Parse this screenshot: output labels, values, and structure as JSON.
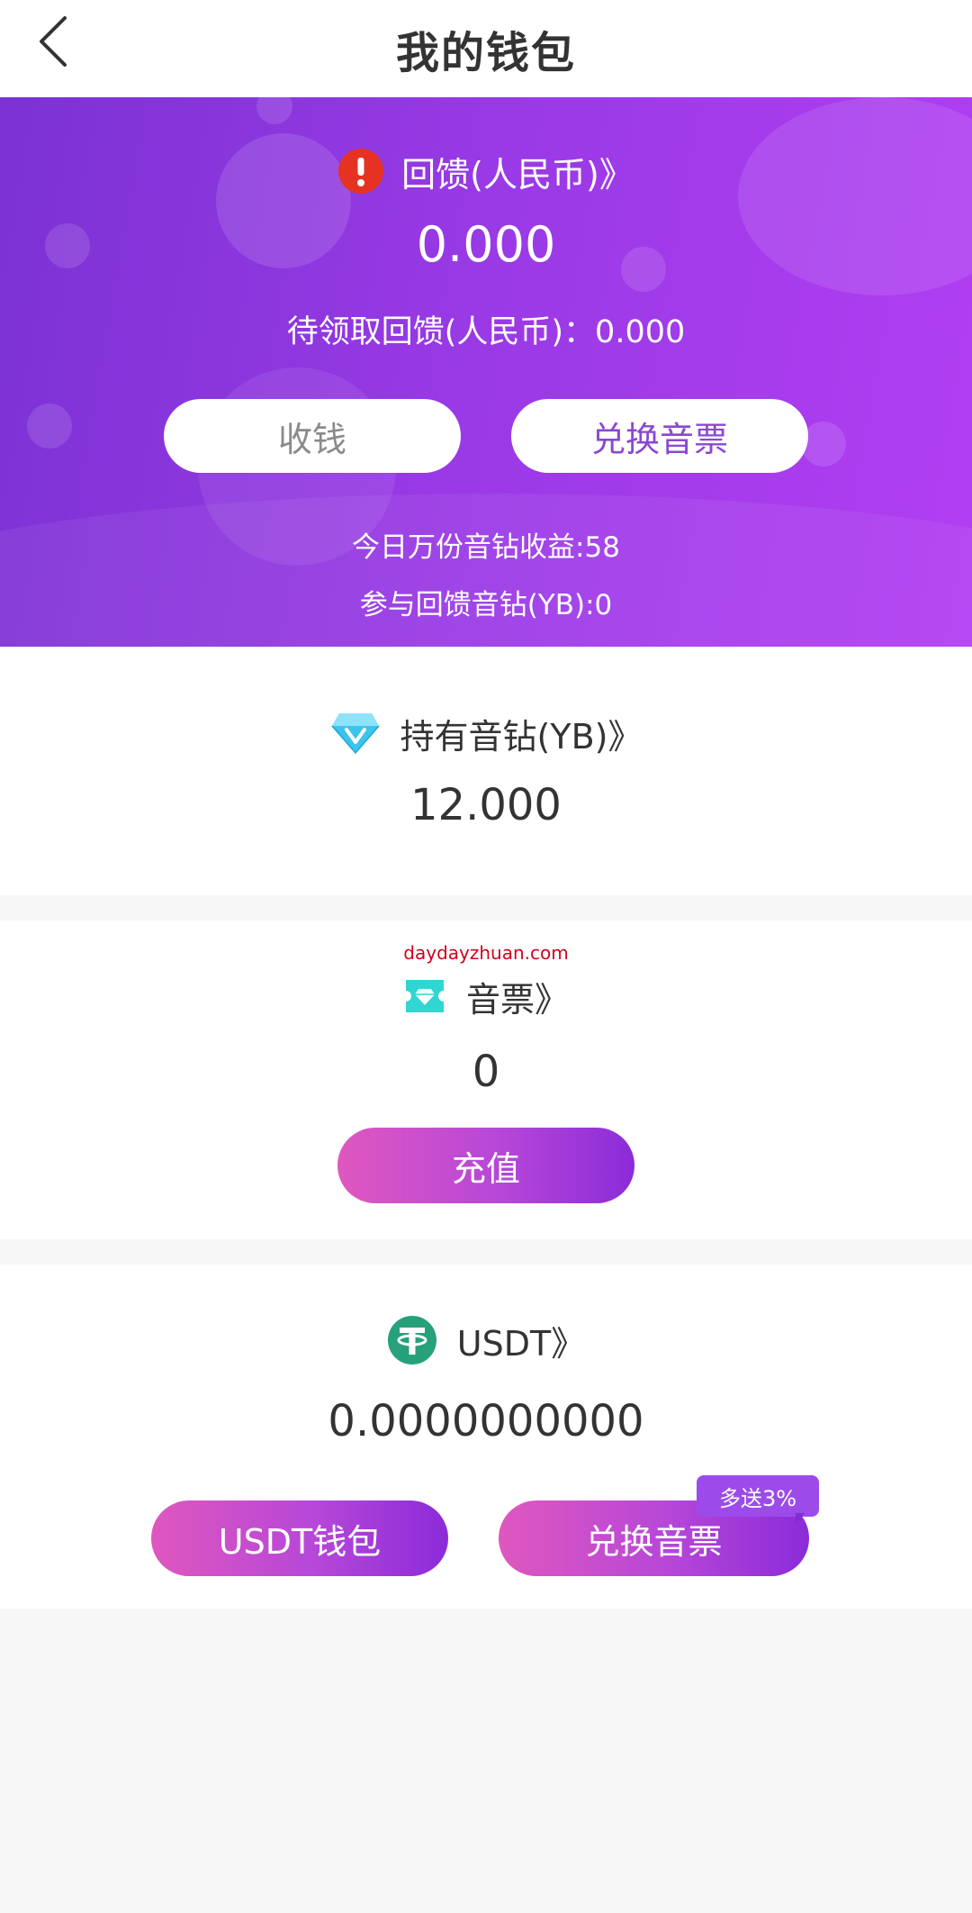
{
  "header": {
    "title": "我的钱包"
  },
  "hero": {
    "label": "回馈(人民币)》",
    "balance": "0.000",
    "pending": "待领取回馈(人民币)：0.000",
    "collect_label": "收钱",
    "exchange_label": "兑换音票",
    "today_yield": "今日万份音钻收益:58",
    "participating": "参与回馈音钻(YB):0"
  },
  "yb": {
    "label": "持有音钻(YB)》",
    "value": "12.000"
  },
  "ticket": {
    "watermark": "daydayzhuan.com",
    "label": "音票》",
    "value": "0",
    "recharge_label": "充值"
  },
  "usdt": {
    "label": "USDT》",
    "value": "0.0000000000",
    "wallet_label": "USDT钱包",
    "exchange_label": "兑换音票",
    "badge": "多送3%"
  },
  "colors": {
    "hero_gradient_start": "#7b32d4",
    "hero_gradient_end": "#b23ef3",
    "button_gradient_start": "#df57bf",
    "button_gradient_end": "#8b2bd9",
    "warn": "#e53223",
    "usdt_green": "#26a17b"
  },
  "icons": {
    "back": "chevron-left-icon",
    "warning": "warning-icon",
    "diamond": "diamond-icon",
    "ticket": "ticket-icon",
    "usdt": "tether-icon"
  }
}
